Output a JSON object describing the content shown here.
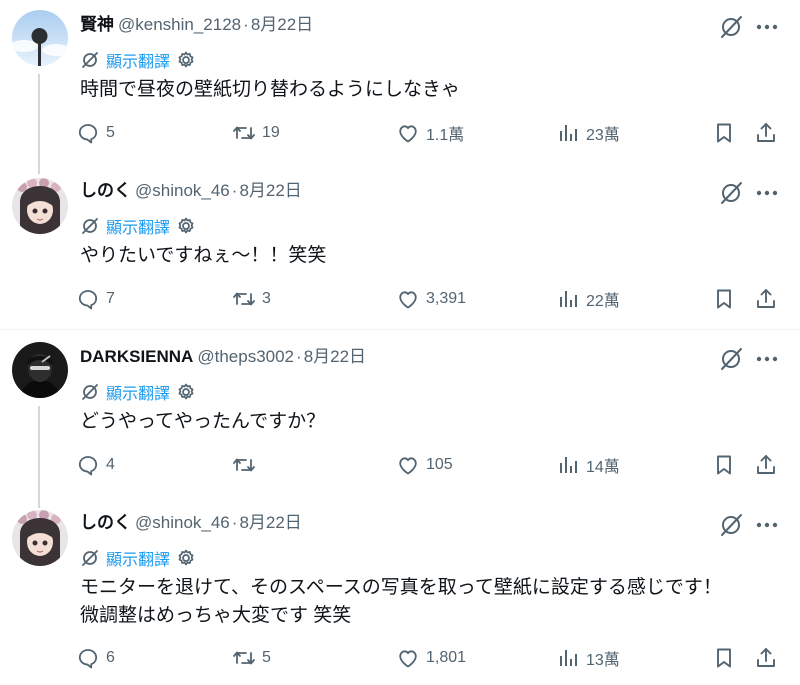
{
  "colors": {
    "accent": "#1d9bf0",
    "muted": "#536471",
    "text": "#0f1419",
    "thread_line": "#cfd9de"
  },
  "translate_label": "顯示翻譯",
  "tweets": [
    {
      "name": "賢神",
      "handle": "@kenshin_2128",
      "date": "8月22日",
      "text_lines": [
        "時間で昼夜の壁紙切り替わるようにしなきゃ"
      ],
      "replies": "5",
      "retweets": "19",
      "likes": "1.1萬",
      "views": "23萬",
      "avatar": "avatar-tree-sky"
    },
    {
      "name": "しのく",
      "handle": "@shinok_46",
      "date": "8月22日",
      "text_lines": [
        "やりたいですねぇ〜！！笑笑"
      ],
      "replies": "7",
      "retweets": "3",
      "likes": "3,391",
      "views": "22萬",
      "avatar": "avatar-anime-girl"
    },
    {
      "name": "DARKSIENNA",
      "handle": "@theps3002",
      "date": "8月22日",
      "text_lines": [
        "どうやってやったんですか？"
      ],
      "replies": "4",
      "retweets": "",
      "likes": "105",
      "views": "14萬",
      "avatar": "avatar-dark-figure"
    },
    {
      "name": "しのく",
      "handle": "@shinok_46",
      "date": "8月22日",
      "text_lines": [
        "モニターを退けて、そのスペースの写真を取って壁紙に設定する感じです！",
        "微調整はめっちゃ大変です 笑笑"
      ],
      "replies": "6",
      "retweets": "5",
      "likes": "1,801",
      "views": "13萬",
      "avatar": "avatar-anime-girl"
    }
  ]
}
